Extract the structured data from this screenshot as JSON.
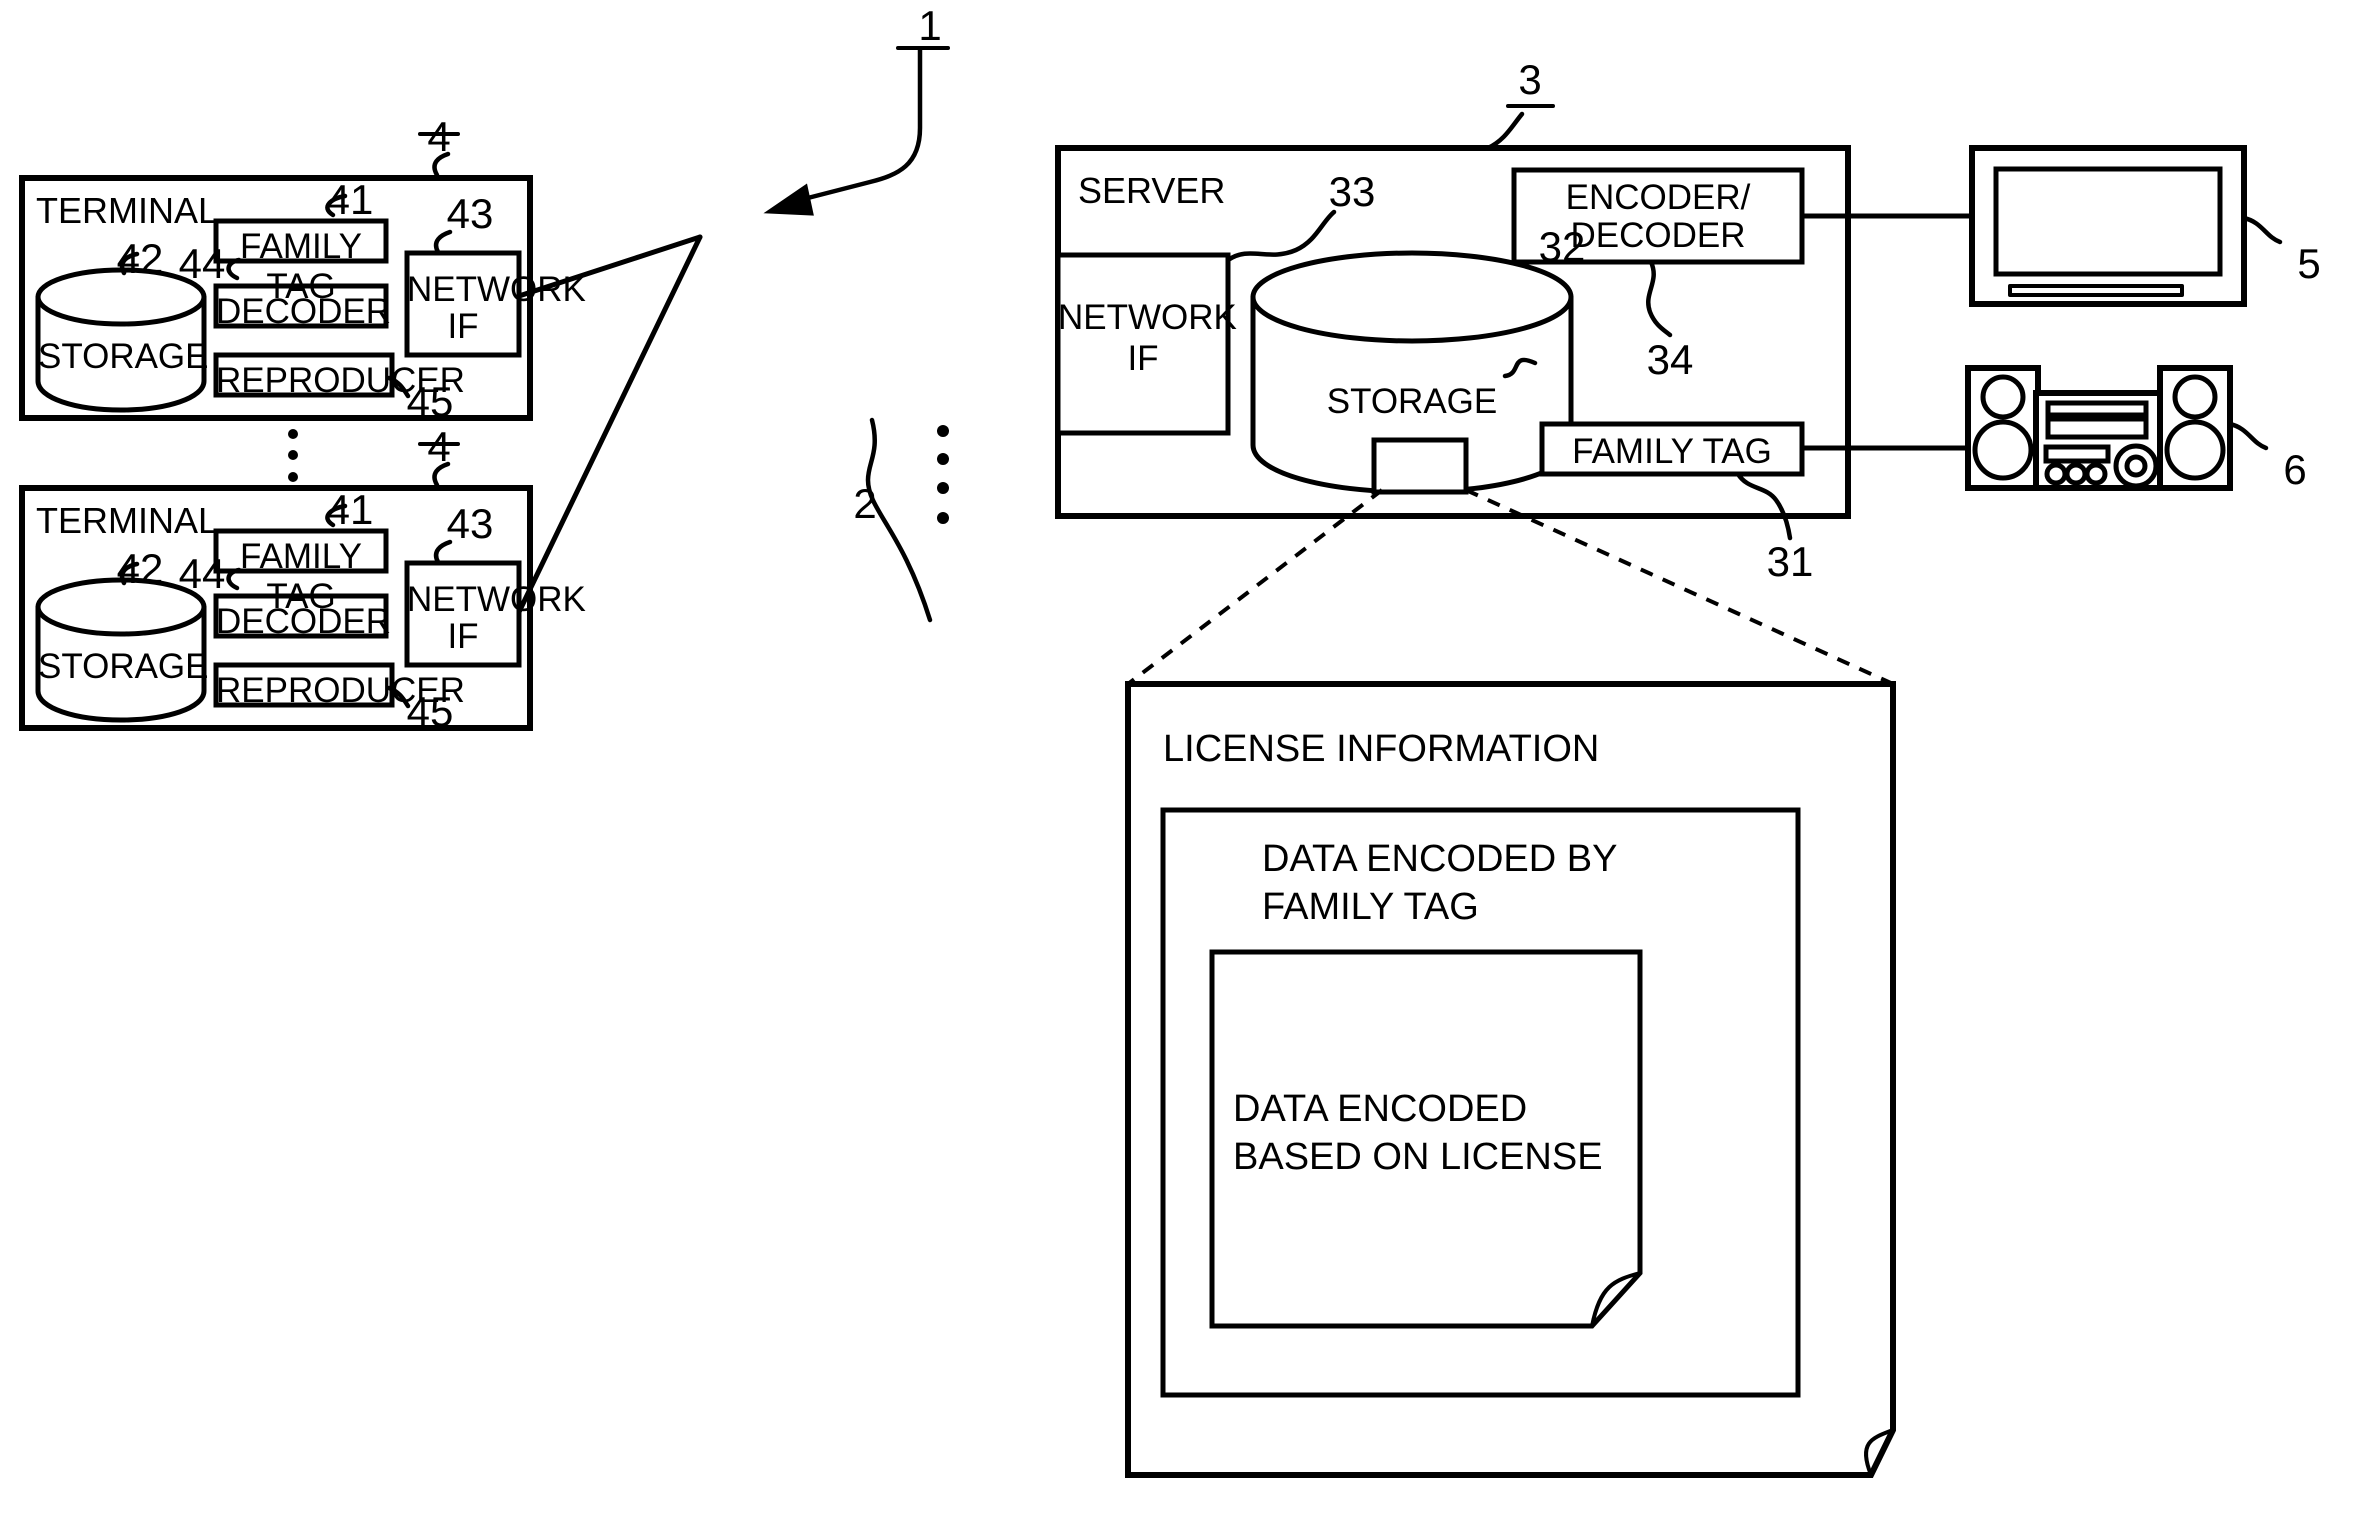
{
  "figure": {
    "system_ref": "1",
    "network_ref": "2",
    "server_ref": "3",
    "terminal_ref": "4",
    "display_ref": "5",
    "audio_ref": "6"
  },
  "terminals": [
    {
      "title": "TERMINAL",
      "ref": "4",
      "storage": {
        "label": "STORAGE",
        "ref": "42"
      },
      "family_tag": {
        "label": "FAMILY TAG",
        "ref": "41"
      },
      "decoder": {
        "label": "DECODER",
        "ref": "44"
      },
      "reproducer": {
        "label": "REPRODUCER",
        "ref": "45"
      },
      "network_if": {
        "label_line1": "NETWORK",
        "label_line2": "IF",
        "ref": "43"
      }
    },
    {
      "title": "TERMINAL",
      "ref": "4",
      "storage": {
        "label": "STORAGE",
        "ref": "42"
      },
      "family_tag": {
        "label": "FAMILY TAG",
        "ref": "41"
      },
      "decoder": {
        "label": "DECODER",
        "ref": "44"
      },
      "reproducer": {
        "label": "REPRODUCER",
        "ref": "45"
      },
      "network_if": {
        "label_line1": "NETWORK",
        "label_line2": "IF",
        "ref": "43"
      }
    }
  ],
  "server": {
    "title": "SERVER",
    "ref": "3",
    "network_if": {
      "label_line1": "NETWORK",
      "label_line2": "IF",
      "ref": "33"
    },
    "storage": {
      "label": "STORAGE",
      "ref": "32"
    },
    "encoder_decoder": {
      "label_line1": "ENCODER/",
      "label_line2": "DECODER",
      "ref": "34"
    },
    "family_tag": {
      "label": "FAMILY TAG",
      "ref": "31"
    }
  },
  "devices": {
    "display": {
      "name": "television-display",
      "ref": "5"
    },
    "audio": {
      "name": "stereo-audio-system",
      "ref": "6"
    }
  },
  "license_document": {
    "title": "LICENSE INFORMATION",
    "outer_layer": {
      "line1": "DATA ENCODED BY",
      "line2": "FAMILY TAG"
    },
    "inner_layer": {
      "line1": "DATA ENCODED",
      "line2": "BASED ON LICENSE"
    }
  },
  "colors": {
    "ink": "#000000",
    "paper": "#ffffff"
  }
}
